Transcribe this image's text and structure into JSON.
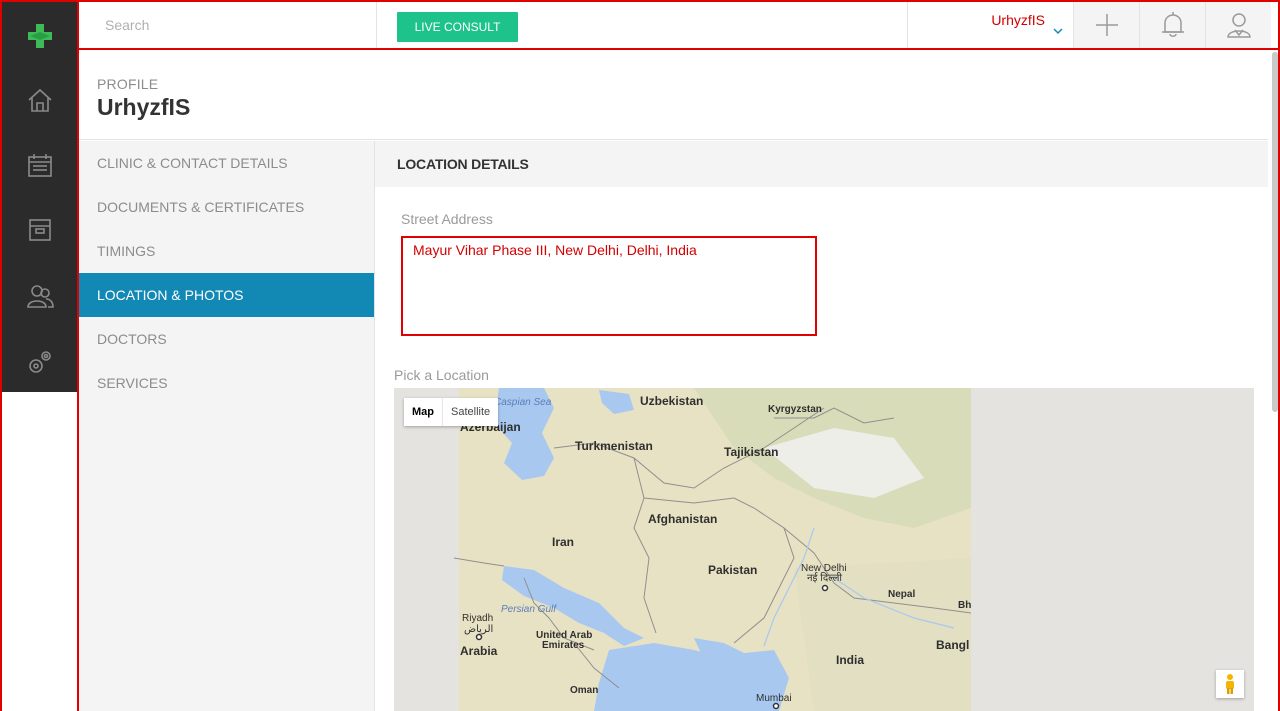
{
  "topbar": {
    "search_placeholder": "Search",
    "live_consult": "LIVE CONSULT",
    "user_name": "UrhyzfIS"
  },
  "header": {
    "section": "PROFILE",
    "title": "UrhyzfIS"
  },
  "left_nav": {
    "items": [
      {
        "label": "CLINIC & CONTACT DETAILS"
      },
      {
        "label": "DOCUMENTS & CERTIFICATES"
      },
      {
        "label": "TIMINGS"
      },
      {
        "label": "LOCATION & PHOTOS"
      },
      {
        "label": "DOCTORS"
      },
      {
        "label": "SERVICES"
      }
    ]
  },
  "content": {
    "section_title": "LOCATION DETAILS",
    "street_label": "Street Address",
    "street_value": "Mayur Vihar Phase III, New Delhi, Delhi, India",
    "pick_label": "Pick a Location",
    "map": {
      "map_btn": "Map",
      "satellite_btn": "Satellite",
      "labels": {
        "caspian": "Caspian Sea",
        "uzbekistan": "Uzbekistan",
        "kyrgyzstan": "Kyrgyzstan",
        "azerbaijan": "Azerbaijan",
        "turkmenistan": "Turkmenistan",
        "tajikistan": "Tajikistan",
        "afghanistan": "Afghanistan",
        "iran": "Iran",
        "pakistan": "Pakistan",
        "new_delhi": "New Delhi",
        "new_delhi_hi": "नई दिल्ली",
        "nepal": "Nepal",
        "bhutan": "Bh",
        "persian_gulf": "Persian Gulf",
        "riyadh": "Riyadh",
        "riyadh_ar": "الرياض",
        "uae1": "United Arab",
        "uae2": "Emirates",
        "arabia": "Arabia",
        "india": "India",
        "bangladesh": "Bangl",
        "oman": "Oman",
        "mumbai": "Mumbai"
      }
    }
  },
  "colors": {
    "rail_bg": "#2b2b2b",
    "accent_blue": "#1288b5",
    "consult_green": "#1ec28b",
    "highlight_red": "#e00000"
  }
}
